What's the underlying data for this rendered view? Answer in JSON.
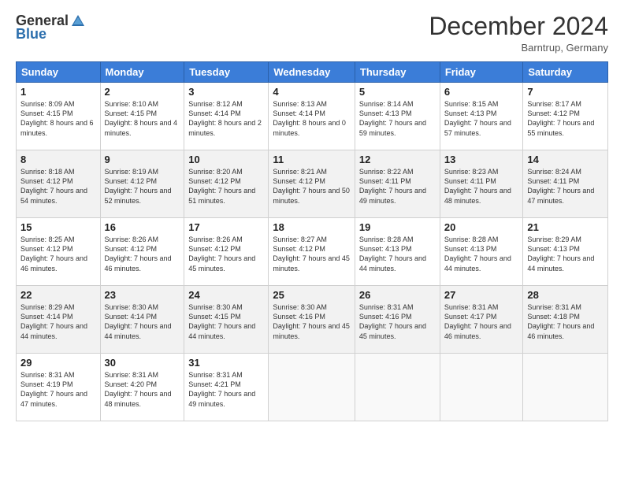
{
  "header": {
    "logo_general": "General",
    "logo_blue": "Blue",
    "month_title": "December 2024",
    "location": "Barntrup, Germany"
  },
  "weekdays": [
    "Sunday",
    "Monday",
    "Tuesday",
    "Wednesday",
    "Thursday",
    "Friday",
    "Saturday"
  ],
  "weeks": [
    [
      {
        "day": "1",
        "sunrise": "8:09 AM",
        "sunset": "4:15 PM",
        "daylight": "8 hours and 6 minutes."
      },
      {
        "day": "2",
        "sunrise": "8:10 AM",
        "sunset": "4:15 PM",
        "daylight": "8 hours and 4 minutes."
      },
      {
        "day": "3",
        "sunrise": "8:12 AM",
        "sunset": "4:14 PM",
        "daylight": "8 hours and 2 minutes."
      },
      {
        "day": "4",
        "sunrise": "8:13 AM",
        "sunset": "4:14 PM",
        "daylight": "8 hours and 0 minutes."
      },
      {
        "day": "5",
        "sunrise": "8:14 AM",
        "sunset": "4:13 PM",
        "daylight": "7 hours and 59 minutes."
      },
      {
        "day": "6",
        "sunrise": "8:15 AM",
        "sunset": "4:13 PM",
        "daylight": "7 hours and 57 minutes."
      },
      {
        "day": "7",
        "sunrise": "8:17 AM",
        "sunset": "4:12 PM",
        "daylight": "7 hours and 55 minutes."
      }
    ],
    [
      {
        "day": "8",
        "sunrise": "8:18 AM",
        "sunset": "4:12 PM",
        "daylight": "7 hours and 54 minutes."
      },
      {
        "day": "9",
        "sunrise": "8:19 AM",
        "sunset": "4:12 PM",
        "daylight": "7 hours and 52 minutes."
      },
      {
        "day": "10",
        "sunrise": "8:20 AM",
        "sunset": "4:12 PM",
        "daylight": "7 hours and 51 minutes."
      },
      {
        "day": "11",
        "sunrise": "8:21 AM",
        "sunset": "4:12 PM",
        "daylight": "7 hours and 50 minutes."
      },
      {
        "day": "12",
        "sunrise": "8:22 AM",
        "sunset": "4:11 PM",
        "daylight": "7 hours and 49 minutes."
      },
      {
        "day": "13",
        "sunrise": "8:23 AM",
        "sunset": "4:11 PM",
        "daylight": "7 hours and 48 minutes."
      },
      {
        "day": "14",
        "sunrise": "8:24 AM",
        "sunset": "4:11 PM",
        "daylight": "7 hours and 47 minutes."
      }
    ],
    [
      {
        "day": "15",
        "sunrise": "8:25 AM",
        "sunset": "4:12 PM",
        "daylight": "7 hours and 46 minutes."
      },
      {
        "day": "16",
        "sunrise": "8:26 AM",
        "sunset": "4:12 PM",
        "daylight": "7 hours and 46 minutes."
      },
      {
        "day": "17",
        "sunrise": "8:26 AM",
        "sunset": "4:12 PM",
        "daylight": "7 hours and 45 minutes."
      },
      {
        "day": "18",
        "sunrise": "8:27 AM",
        "sunset": "4:12 PM",
        "daylight": "7 hours and 45 minutes."
      },
      {
        "day": "19",
        "sunrise": "8:28 AM",
        "sunset": "4:13 PM",
        "daylight": "7 hours and 44 minutes."
      },
      {
        "day": "20",
        "sunrise": "8:28 AM",
        "sunset": "4:13 PM",
        "daylight": "7 hours and 44 minutes."
      },
      {
        "day": "21",
        "sunrise": "8:29 AM",
        "sunset": "4:13 PM",
        "daylight": "7 hours and 44 minutes."
      }
    ],
    [
      {
        "day": "22",
        "sunrise": "8:29 AM",
        "sunset": "4:14 PM",
        "daylight": "7 hours and 44 minutes."
      },
      {
        "day": "23",
        "sunrise": "8:30 AM",
        "sunset": "4:14 PM",
        "daylight": "7 hours and 44 minutes."
      },
      {
        "day": "24",
        "sunrise": "8:30 AM",
        "sunset": "4:15 PM",
        "daylight": "7 hours and 44 minutes."
      },
      {
        "day": "25",
        "sunrise": "8:30 AM",
        "sunset": "4:16 PM",
        "daylight": "7 hours and 45 minutes."
      },
      {
        "day": "26",
        "sunrise": "8:31 AM",
        "sunset": "4:16 PM",
        "daylight": "7 hours and 45 minutes."
      },
      {
        "day": "27",
        "sunrise": "8:31 AM",
        "sunset": "4:17 PM",
        "daylight": "7 hours and 46 minutes."
      },
      {
        "day": "28",
        "sunrise": "8:31 AM",
        "sunset": "4:18 PM",
        "daylight": "7 hours and 46 minutes."
      }
    ],
    [
      {
        "day": "29",
        "sunrise": "8:31 AM",
        "sunset": "4:19 PM",
        "daylight": "7 hours and 47 minutes."
      },
      {
        "day": "30",
        "sunrise": "8:31 AM",
        "sunset": "4:20 PM",
        "daylight": "7 hours and 48 minutes."
      },
      {
        "day": "31",
        "sunrise": "8:31 AM",
        "sunset": "4:21 PM",
        "daylight": "7 hours and 49 minutes."
      },
      null,
      null,
      null,
      null
    ]
  ]
}
